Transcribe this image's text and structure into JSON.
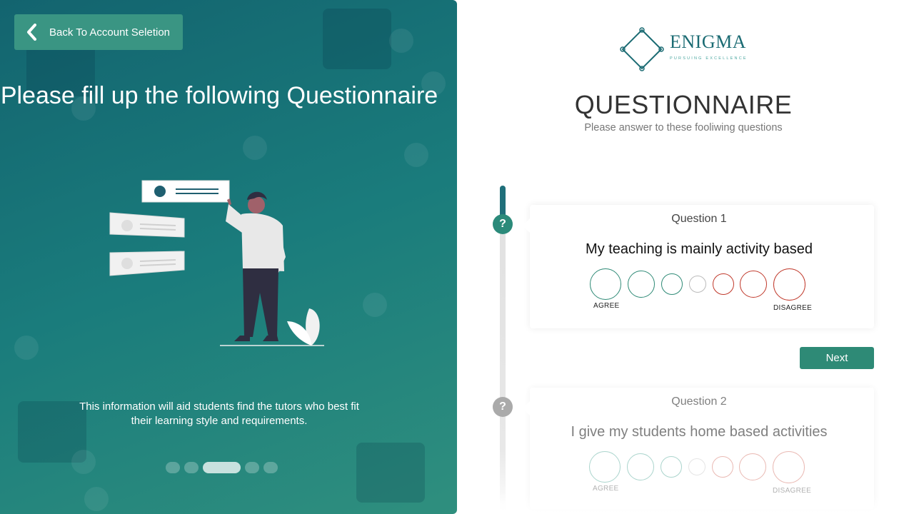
{
  "left_panel": {
    "back_button_label": "Back To Account Seletion",
    "heading": "Please fill up the following Questionnaire",
    "caption": "This information will aid students find the tutors who best fit their learning style and requirements.",
    "carousel": {
      "total": 5,
      "active_index": 2
    },
    "background_colors": [
      "#13646f",
      "#2f8f7e"
    ]
  },
  "brand": {
    "name": "ENIGMA",
    "tagline": "PURSUING EXCELLENCE",
    "color": "#1b6b73"
  },
  "header": {
    "title": "QUESTIONNAIRE",
    "subtitle": "Please answer to these fooliwing questions"
  },
  "progress": {
    "current_question": 1,
    "accent": "#1f6f7a"
  },
  "questions": [
    {
      "number_label": "Question 1",
      "text": "My teaching is mainly activity based",
      "scale": {
        "left_label": "AGREE",
        "right_label": "DISAGREE",
        "options": 7
      },
      "status_icon": "question-mark-icon",
      "state": "active"
    },
    {
      "number_label": "Question 2",
      "text": "I give my students home based activities",
      "scale": {
        "left_label": "AGREE",
        "right_label": "DISAGREE",
        "options": 7
      },
      "status_icon": "question-mark-icon",
      "state": "inactive"
    }
  ],
  "actions": {
    "next_label": "Next"
  },
  "colors": {
    "agree": "#2e8a76",
    "neutral": "#bbbbbb",
    "disagree": "#c0392b",
    "button": "#2e8a76"
  }
}
